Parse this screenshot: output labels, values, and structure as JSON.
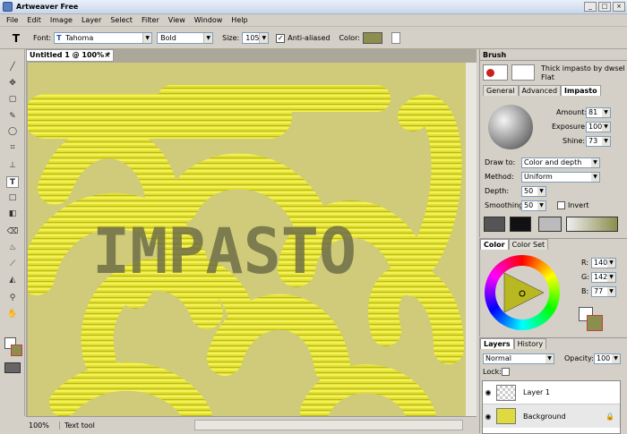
{
  "window": {
    "title": "Artweaver Free",
    "btn_min": "_",
    "btn_max": "□",
    "btn_close": "×"
  },
  "menu": [
    "File",
    "Edit",
    "Image",
    "Layer",
    "Select",
    "Filter",
    "View",
    "Window",
    "Help"
  ],
  "options": {
    "tool_glyph": "T",
    "font_label": "Font:",
    "font_value": "Tahoma",
    "font_icon": "T",
    "style_value": "Bold",
    "size_label": "Size:",
    "size_value": "105",
    "antialias_label": "Anti-aliased",
    "antialias_checked": "✓",
    "color_label": "Color:",
    "color_hex": "#8c8e4d"
  },
  "document": {
    "tab_title": "Untitled 1 @ 100% *",
    "close": "×",
    "canvas_text": "IMPASTO"
  },
  "status": {
    "zoom": "100%",
    "tool": "Text tool"
  },
  "brush": {
    "title": "Brush",
    "preset_name": "Thick impasto by dwsel",
    "preset_sub": "Flat",
    "tabs": [
      "General",
      "Advanced",
      "Impasto"
    ],
    "amount_label": "Amount:",
    "amount": "81",
    "exposure_label": "Exposure:",
    "exposure": "100",
    "shine_label": "Shine:",
    "shine": "73",
    "drawto_label": "Draw to:",
    "drawto": "Color and depth",
    "method_label": "Method:",
    "method": "Uniform",
    "depth_label": "Depth:",
    "depth": "50",
    "smoothing_label": "Smoothing:",
    "smoothing": "50",
    "invert_label": "Invert"
  },
  "color": {
    "tabs": [
      "Color",
      "Color Set"
    ],
    "r_label": "R:",
    "r": "140",
    "g_label": "G:",
    "g": "142",
    "b_label": "B:",
    "b": "77",
    "fg_hex": "#8c8e4d",
    "bg_hex": "#ffffff"
  },
  "layers": {
    "tabs": [
      "Layers",
      "History"
    ],
    "blend": "Normal",
    "opacity_label": "Opacity:",
    "opacity": "100",
    "lock_label": "Lock:",
    "items": [
      {
        "name": "Layer 1"
      },
      {
        "name": "Background"
      }
    ]
  }
}
